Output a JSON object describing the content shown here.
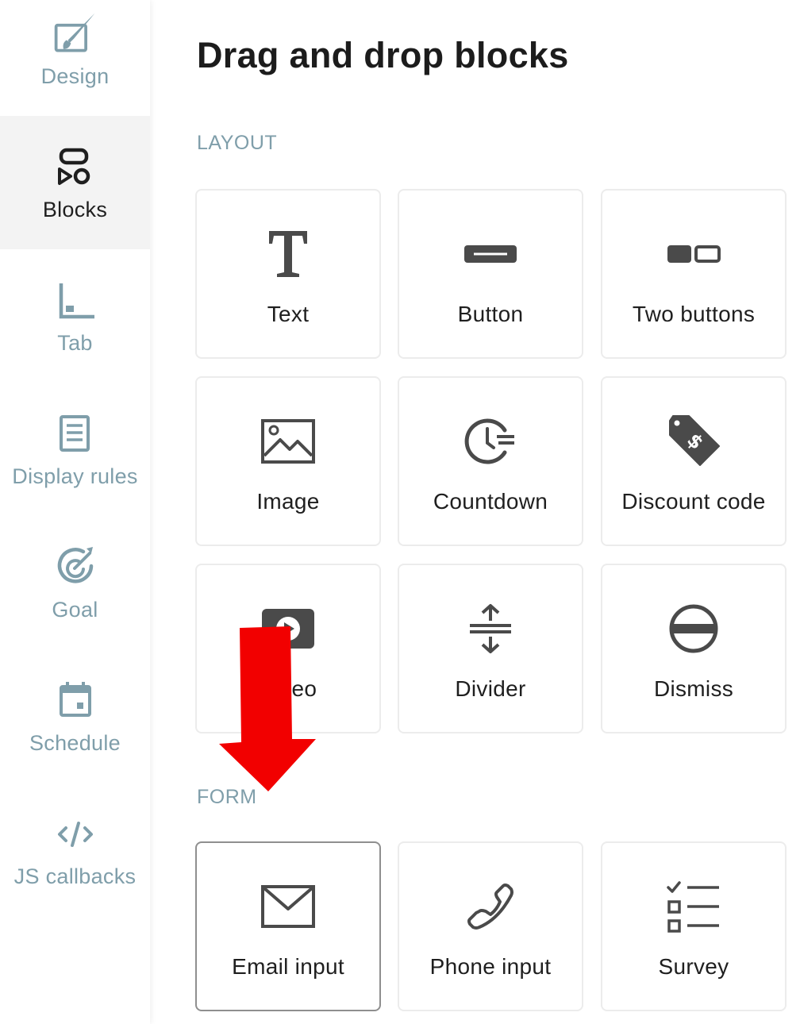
{
  "sidebar": {
    "items": [
      {
        "id": "design",
        "label": "Design",
        "icon": "design-icon",
        "active": false
      },
      {
        "id": "blocks",
        "label": "Blocks",
        "icon": "blocks-icon",
        "active": true
      },
      {
        "id": "tab",
        "label": "Tab",
        "icon": "tab-icon",
        "active": false
      },
      {
        "id": "display-rules",
        "label": "Display rules",
        "icon": "display-rules-icon",
        "active": false
      },
      {
        "id": "goal",
        "label": "Goal",
        "icon": "goal-icon",
        "active": false
      },
      {
        "id": "schedule",
        "label": "Schedule",
        "icon": "calendar-icon",
        "active": false
      },
      {
        "id": "js-callbacks",
        "label": "JS callbacks",
        "icon": "code-icon",
        "active": false
      }
    ]
  },
  "main": {
    "title": "Drag and drop blocks",
    "sections": [
      {
        "title": "LAYOUT",
        "blocks": [
          {
            "label": "Text",
            "icon": "text-icon"
          },
          {
            "label": "Button",
            "icon": "button-icon"
          },
          {
            "label": "Two buttons",
            "icon": "two-buttons-icon"
          },
          {
            "label": "Image",
            "icon": "image-icon"
          },
          {
            "label": "Countdown",
            "icon": "countdown-icon"
          },
          {
            "label": "Discount code",
            "icon": "discount-tag-icon"
          },
          {
            "label": "Video",
            "icon": "video-icon"
          },
          {
            "label": "Divider",
            "icon": "divider-icon"
          },
          {
            "label": "Dismiss",
            "icon": "dismiss-icon"
          }
        ]
      },
      {
        "title": "FORM",
        "blocks": [
          {
            "label": "Email input",
            "icon": "envelope-icon",
            "selected": true
          },
          {
            "label": "Phone input",
            "icon": "phone-icon"
          },
          {
            "label": "Survey",
            "icon": "survey-list-icon"
          }
        ]
      }
    ]
  },
  "colors": {
    "sidebar_muted": "#7f9eaa",
    "sidebar_active_bg": "#f3f3f3",
    "text_dark": "#1f1f1f",
    "icon_gray": "#4a4a4a",
    "annotation_arrow": "#f20000"
  },
  "annotation": {
    "icon": "red-down-arrow-icon"
  }
}
